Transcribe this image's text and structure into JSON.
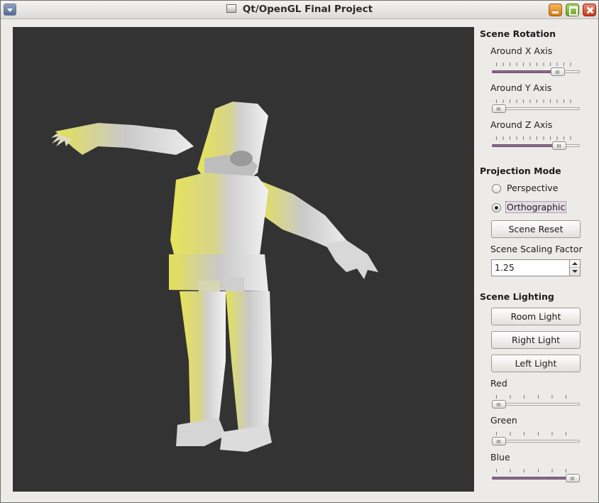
{
  "window": {
    "title": "Qt/OpenGL Final Project"
  },
  "rotation": {
    "title": "Scene Rotation",
    "x_label": "Around X Axis",
    "y_label": "Around Y Axis",
    "z_label": "Around Z Axis",
    "x_value": 0.8,
    "y_value": 0.0,
    "z_value": 0.82
  },
  "projection": {
    "title": "Projection Mode",
    "options": [
      "Perspective",
      "Orthographic"
    ],
    "selected": "Orthographic",
    "reset_label": "Scene Reset",
    "scaling_label": "Scene Scaling Factor",
    "scaling_value": "1.25"
  },
  "lighting": {
    "title": "Scene Lighting",
    "buttons": [
      "Room Light",
      "Right Light",
      "Left Light"
    ],
    "red_label": "Red",
    "green_label": "Green",
    "blue_label": "Blue",
    "red_value": 0.0,
    "green_value": 0.0,
    "blue_value": 1.0
  },
  "colors": {
    "viewport_bg": "#333333",
    "model_light": "#e8e8e8",
    "model_yellow": "#e6e35a",
    "slider_fill": "#8a6a8c"
  },
  "icons": [
    "window-menu-icon",
    "app-icon",
    "minimize-icon",
    "maximize-icon",
    "close-icon"
  ]
}
